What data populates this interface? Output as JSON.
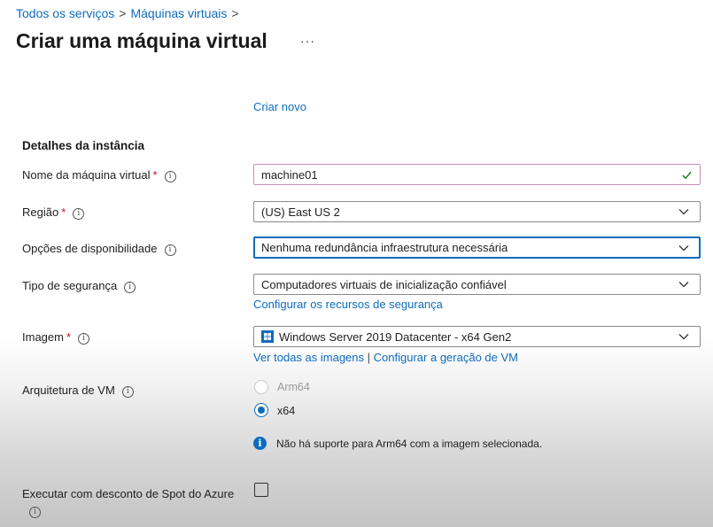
{
  "breadcrumb": {
    "item1": "Todos os serviços",
    "item2": "Máquinas virtuais",
    "separator": ">"
  },
  "page": {
    "title": "Criar uma máquina virtual",
    "more_label": "···"
  },
  "create_new_link": "Criar novo",
  "section_title": "Detalhes da instância",
  "fields": {
    "vm_name": {
      "label": "Nome da máquina virtual",
      "required": "*",
      "value": "machine01"
    },
    "region": {
      "label": "Região",
      "required": "*",
      "value": "(US) East US 2"
    },
    "availability": {
      "label": "Opções de disponibilidade",
      "value": "Nenhuma redundância infraestrutura necessária"
    },
    "security": {
      "label": "Tipo de segurança",
      "value": "Computadores virtuais de inicialização confiável",
      "link": "Configurar os recursos de segurança"
    },
    "image": {
      "label": "Imagem",
      "required": "*",
      "value": "Windows Server 2019 Datacenter - x64 Gen2",
      "link1": "Ver todas as imagens",
      "link_sep": "|",
      "link2": "Configurar a geração de VM"
    },
    "architecture": {
      "label": "Arquitetura de VM",
      "options": [
        "Arm64",
        "x64"
      ],
      "selected": "x64",
      "info": "Não há suporte para Arm64 com a imagem selecionada."
    },
    "spot": {
      "label": "Executar com desconto de Spot do Azure",
      "checked": false
    }
  },
  "icons": {
    "info": "i",
    "valid": "check-icon",
    "chevron": "chevron-down-icon",
    "windows": "windows-logo-icon"
  },
  "colors": {
    "accent": "#0f6cbd",
    "required": "#c50f1f",
    "valid": "#107c10"
  }
}
